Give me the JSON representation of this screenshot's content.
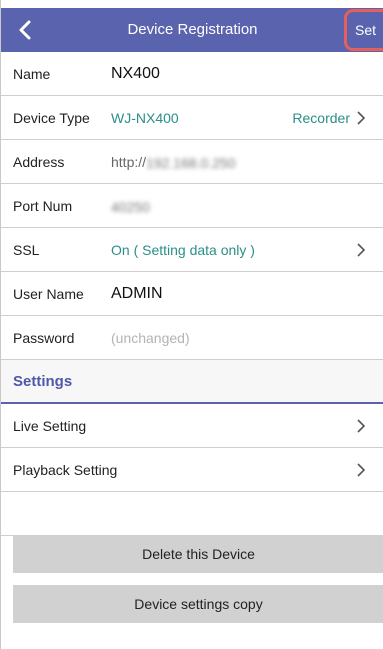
{
  "header": {
    "title": "Device Registration",
    "set_label": "Set",
    "back_icon": "chevron-left-icon",
    "accent": "#5a63ad",
    "highlight": "#e5605a"
  },
  "fields": {
    "name": {
      "label": "Name",
      "value": "NX400"
    },
    "device_type": {
      "label": "Device Type",
      "value": "WJ-NX400",
      "category": "Recorder"
    },
    "address": {
      "label": "Address",
      "prefix": "http://",
      "value": "192.168.0.250"
    },
    "port": {
      "label": "Port Num",
      "value": "40250"
    },
    "ssl": {
      "label": "SSL",
      "value": "On ( Setting data only )"
    },
    "user": {
      "label": "User Name",
      "value": "ADMIN"
    },
    "password": {
      "label": "Password",
      "placeholder": "(unchanged)"
    }
  },
  "settings": {
    "heading": "Settings",
    "live": "Live Setting",
    "playback": "Playback Setting"
  },
  "buttons": {
    "delete": "Delete this Device",
    "copy": "Device settings copy"
  }
}
